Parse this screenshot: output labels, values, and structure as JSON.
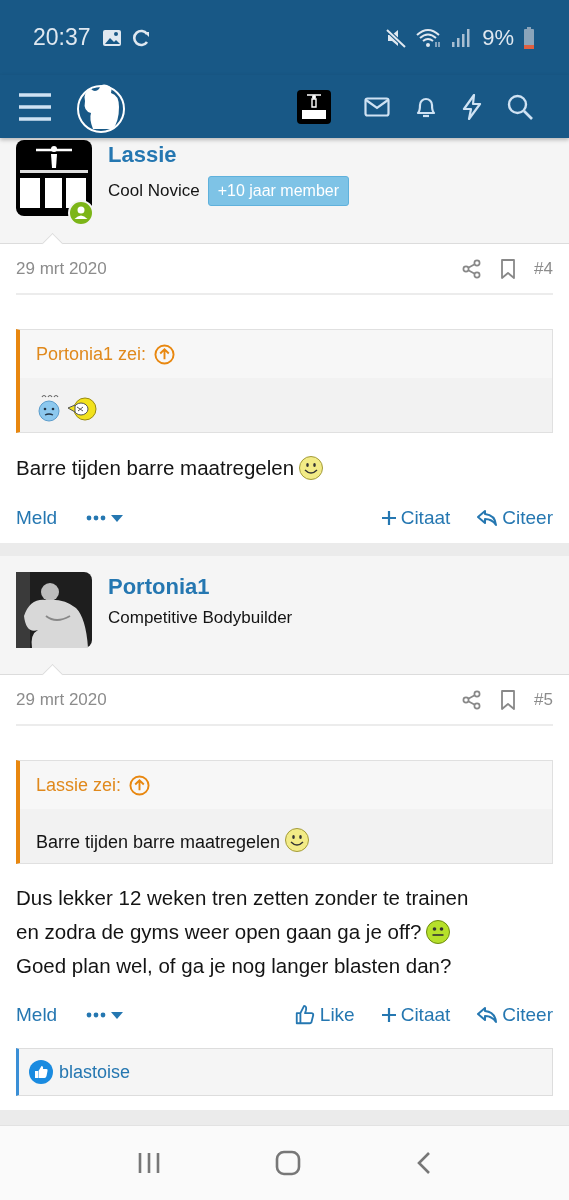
{
  "status_bar": {
    "time": "20:37",
    "battery": "9%"
  },
  "posts": [
    {
      "author": "Lassie",
      "user_title": "Cool Novice",
      "banner": "+10 jaar member",
      "online": true,
      "date": "29 mrt 2020",
      "number": "#4",
      "quote": {
        "author": "Portonia1 zei:",
        "lines": [
          {
            "smileys": [
              {
                "kind": "confused"
              },
              {
                "kind": "yawning"
              }
            ]
          }
        ]
      },
      "body": [
        {
          "text": "Barre tijden barre maatregelen",
          "smileys": [
            {
              "kind": "smile"
            }
          ]
        }
      ],
      "actions": [
        {
          "kind": "report",
          "label": "Meld"
        },
        {
          "kind": "more"
        },
        {
          "kind": "quote",
          "label": "Citaat"
        },
        {
          "kind": "reply",
          "label": "Citeer"
        }
      ]
    },
    {
      "author": "Portonia1",
      "user_title": "Competitive Bodybuilder",
      "online": false,
      "date": "29 mrt 2020",
      "number": "#5",
      "quote": {
        "author": "Lassie zei:",
        "lines": [
          {
            "text": "Barre tijden barre maatregelen",
            "smileys": [
              {
                "kind": "smile"
              }
            ]
          }
        ]
      },
      "body": [
        {
          "text": "Dus lekker 12 weken tren zetten zonder te trainen"
        },
        {
          "text": "en zodra de gyms weer open gaan ga je off?",
          "smileys": [
            {
              "kind": "neutral"
            }
          ]
        },
        {
          "text": "Goed plan wel, of ga je nog langer blasten dan?"
        }
      ],
      "actions": [
        {
          "kind": "report",
          "label": "Meld"
        },
        {
          "kind": "more"
        },
        {
          "kind": "like",
          "label": "Like"
        },
        {
          "kind": "quote",
          "label": "Citaat"
        },
        {
          "kind": "reply",
          "label": "Citeer"
        }
      ],
      "likes": [
        "blastoise"
      ]
    }
  ]
}
